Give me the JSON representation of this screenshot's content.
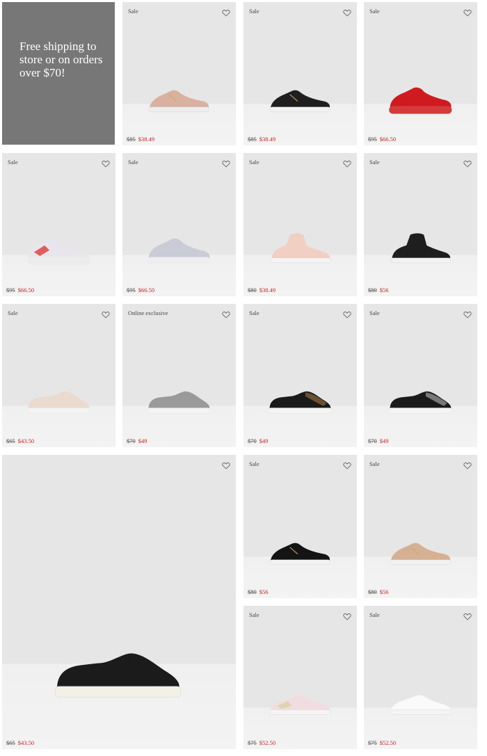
{
  "promo": {
    "text": "Free shipping to store or on orders over $70!"
  },
  "products": [
    {
      "badge": "Sale",
      "orig": "$85",
      "price": "$38.49",
      "shoe": "sneaker-zip",
      "color": "#d9b1a0",
      "sole": "#eeeeee"
    },
    {
      "badge": "Sale",
      "orig": "$85",
      "price": "$38.49",
      "shoe": "sneaker-zip",
      "color": "#1f1f1f",
      "sole": "#f2f2f2"
    },
    {
      "badge": "Sale",
      "orig": "$95",
      "price": "$66.50",
      "shoe": "chunky",
      "color": "#cf1a1f",
      "sole": "#d63b3b"
    },
    {
      "badge": "Sale",
      "orig": "$95",
      "price": "$66.50",
      "shoe": "chunky",
      "color": "#e8e6ec",
      "sole": "#ececec",
      "accent": "#d22"
    },
    {
      "badge": "Sale",
      "orig": "$95",
      "price": "$66.50",
      "shoe": "chunky",
      "color": "#c9ccd6",
      "sole": "#eeeeee"
    },
    {
      "badge": "Sale",
      "orig": "$80",
      "price": "$38.49",
      "shoe": "hightop",
      "color": "#f1cfc2",
      "sole": "#f5f5f5"
    },
    {
      "badge": "Sale",
      "orig": "$80",
      "price": "$56",
      "shoe": "hightop",
      "color": "#1e1e1e",
      "sole": "#f2f2f2"
    },
    {
      "badge": "Sale",
      "orig": "$65",
      "price": "$43.50",
      "shoe": "slipon",
      "color": "#eadbce",
      "sole": "#f4f4f4"
    },
    {
      "badge": "Online exclusive",
      "orig": "$70",
      "price": "$49",
      "shoe": "slipon",
      "color": "#9a9a9a",
      "sole": "#f4f4f4"
    },
    {
      "badge": "Sale",
      "orig": "$70",
      "price": "$49",
      "shoe": "slipon",
      "color": "#1a1a1a",
      "sole": "#f4f4f4",
      "accent": "#7a5a36"
    },
    {
      "badge": "Sale",
      "orig": "$70",
      "price": "$49",
      "shoe": "slipon",
      "color": "#1a1a1a",
      "sole": "#f4f4f4",
      "accent": "#8a8a8a"
    },
    {
      "badge": "",
      "orig": "$65",
      "price": "$43.50",
      "shoe": "slipon-large",
      "color": "#1b1b1b",
      "sole": "#f3f0e8"
    },
    {
      "badge": "Sale",
      "orig": "$80",
      "price": "$56",
      "shoe": "sneaker-zip",
      "color": "#141414",
      "sole": "#f2f2f2"
    },
    {
      "badge": "Sale",
      "orig": "$80",
      "price": "$56",
      "shoe": "sneaker-zip",
      "color": "#d6b093",
      "sole": "#f2f2f2"
    },
    {
      "badge": "Sale",
      "orig": "$75",
      "price": "$52.50",
      "shoe": "lowtop",
      "color": "#f1dde0",
      "sole": "#f4f4f4",
      "accent": "#d8d2a5"
    },
    {
      "badge": "Sale",
      "orig": "$75",
      "price": "$52.50",
      "shoe": "lowtop",
      "color": "#fafafa",
      "sole": "#f4f4f4"
    }
  ]
}
